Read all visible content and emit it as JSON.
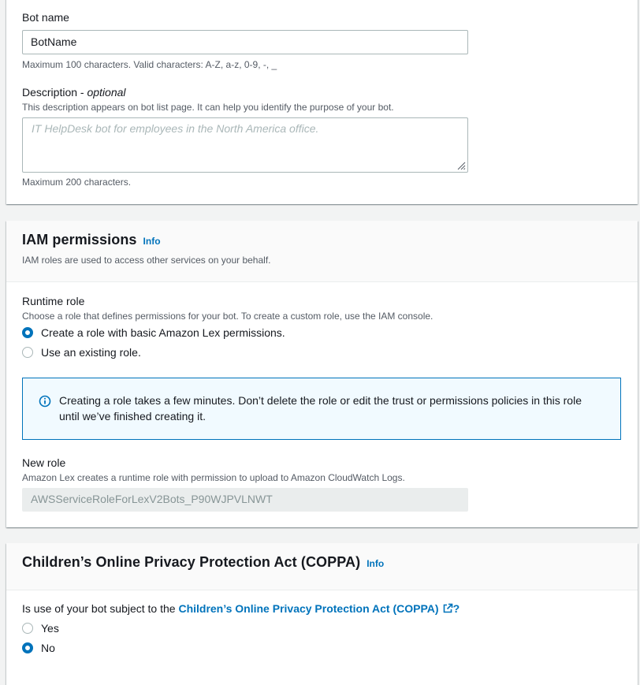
{
  "bot_details": {
    "bot_name_label": "Bot name",
    "bot_name_value": "BotName",
    "bot_name_hint": "Maximum 100 characters. Valid characters: A-Z, a-z, 0-9, -, _",
    "description_label": "Description - ",
    "description_optional": "optional",
    "description_help": "This description appears on bot list page. It can help you identify the purpose of your bot.",
    "description_placeholder": "IT HelpDesk bot for employees in the North America office.",
    "description_hint": "Maximum 200 characters."
  },
  "iam": {
    "title": "IAM permissions",
    "info": "Info",
    "description": "IAM roles are used to access other services on your behalf.",
    "runtime_role_label": "Runtime role",
    "runtime_role_help": "Choose a role that defines permissions for your bot. To create a custom role, use the IAM console.",
    "options": [
      {
        "label": "Create a role with basic Amazon Lex permissions.",
        "checked": true
      },
      {
        "label": "Use an existing role.",
        "checked": false
      }
    ],
    "alert_text": "Creating a role takes a few minutes. Don’t delete the role or edit the trust or permissions policies in this role until we’ve finished creating it.",
    "new_role_label": "New role",
    "new_role_help": "Amazon Lex creates a runtime role with permission to upload to Amazon CloudWatch Logs.",
    "new_role_value": "AWSServiceRoleForLexV2Bots_P90WJPVLNWT"
  },
  "coppa": {
    "title": "Children’s Online Privacy Protection Act (COPPA)",
    "info": "Info",
    "question_prefix": "Is use of your bot subject to the ",
    "question_link": "Children’s Online Privacy Protection Act (COPPA)",
    "question_suffix": "?",
    "options": [
      {
        "label": "Yes",
        "checked": false
      },
      {
        "label": "No",
        "checked": true
      }
    ]
  },
  "colors": {
    "accent": "#0073bb",
    "alert_bg": "#f1faff",
    "page_bg": "#f2f3f3"
  },
  "icons": [
    "info-circle-icon",
    "external-link-icon",
    "resize-grip-icon"
  ]
}
